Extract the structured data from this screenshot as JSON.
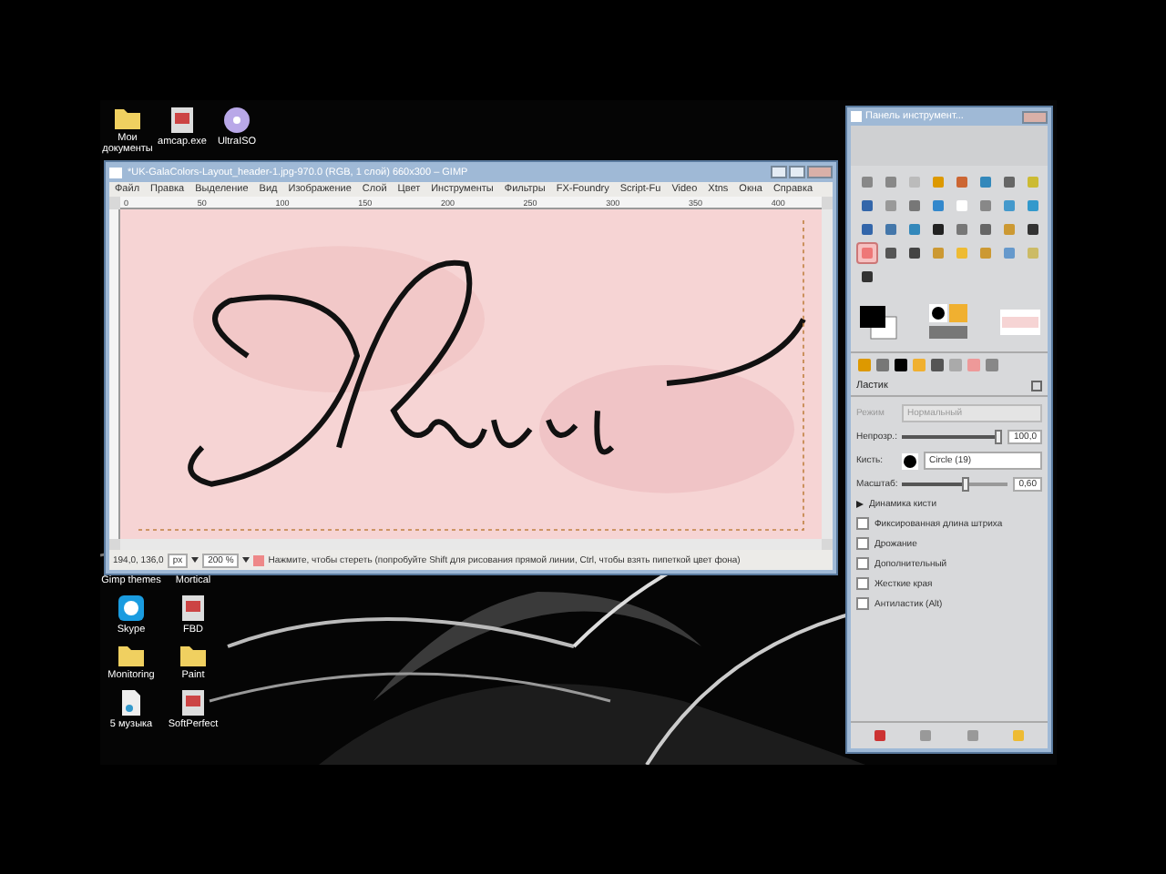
{
  "desktop_icons": [
    {
      "label": "Мои документы",
      "kind": "folder"
    },
    {
      "label": "amcap.exe",
      "kind": "app"
    },
    {
      "label": "UltraISO",
      "kind": "disc"
    }
  ],
  "desktop_column": [
    {
      "label": "Gimp themes",
      "kind": "covered"
    },
    {
      "label": "Mortical",
      "kind": "covered"
    },
    {
      "label": "Skype",
      "kind": "skype"
    },
    {
      "label": "FBD",
      "kind": "app"
    },
    {
      "label": "Monitoring",
      "kind": "folder"
    },
    {
      "label": "Paint",
      "kind": "folder"
    },
    {
      "label": "5 музыка",
      "kind": "file"
    },
    {
      "label": "SoftPerfect",
      "kind": "app"
    }
  ],
  "gimp": {
    "title": "*UK-GalaColors-Layout_header-1.jpg-970.0 (RGB, 1 слой) 660x300 – GIMP",
    "menu": [
      "Файл",
      "Правка",
      "Выделение",
      "Вид",
      "Изображение",
      "Слой",
      "Цвет",
      "Инструменты",
      "Фильтры",
      "FX-Foundry",
      "Script-Fu",
      "Video",
      "Xtns",
      "Окна",
      "Справка"
    ],
    "ruler": [
      "0",
      "50",
      "100",
      "150",
      "200",
      "250",
      "300",
      "350",
      "400"
    ],
    "status": {
      "coords": "194,0, 136,0",
      "unit": "px",
      "zoom": "200 %",
      "message": "Нажмите, чтобы стереть (попробуйте Shift для рисования прямой линии, Ctrl, чтобы взять пипеткой цвет фона)"
    }
  },
  "toolbox": {
    "title": "Панель инструмент...",
    "tools": [
      {
        "selected": false
      },
      {
        "selected": false
      },
      {
        "selected": false
      },
      {
        "selected": false
      },
      {
        "selected": false
      },
      {
        "selected": false
      },
      {
        "selected": false
      },
      {
        "selected": false
      },
      {
        "selected": false
      },
      {
        "selected": false
      },
      {
        "selected": false
      },
      {
        "selected": false
      },
      {
        "selected": false
      },
      {
        "selected": false
      },
      {
        "selected": false
      },
      {
        "selected": false
      },
      {
        "selected": false
      },
      {
        "selected": false
      },
      {
        "selected": false
      },
      {
        "selected": false
      },
      {
        "selected": false
      },
      {
        "selected": false
      },
      {
        "selected": false
      },
      {
        "selected": false
      },
      {
        "selected": true
      },
      {
        "selected": false
      },
      {
        "selected": false
      },
      {
        "selected": false
      },
      {
        "selected": false
      },
      {
        "selected": false
      },
      {
        "selected": false
      },
      {
        "selected": false
      },
      {
        "selected": false
      }
    ],
    "options_title": "Ластик",
    "mode": {
      "label": "Режим",
      "value": "Нормальный",
      "disabled": true
    },
    "opacity": {
      "label": "Непрозр.:",
      "level": 0.95,
      "reading": "100,0"
    },
    "brush": {
      "label": "Кисть:",
      "value": "Circle (19)"
    },
    "scale": {
      "label": "Масштаб:",
      "level": 0.6,
      "reading": "0,60"
    },
    "dynamics": {
      "label": "Динамика кисти",
      "expanded": false
    },
    "checkboxes": [
      {
        "label": "Фиксированная длина штриха",
        "checked": false
      },
      {
        "label": "Дрожание",
        "checked": false
      },
      {
        "label": "Дополнительный",
        "checked": false
      },
      {
        "label": "Жесткие края",
        "checked": false
      },
      {
        "label": "Антиластик (Alt)",
        "checked": false
      }
    ]
  }
}
